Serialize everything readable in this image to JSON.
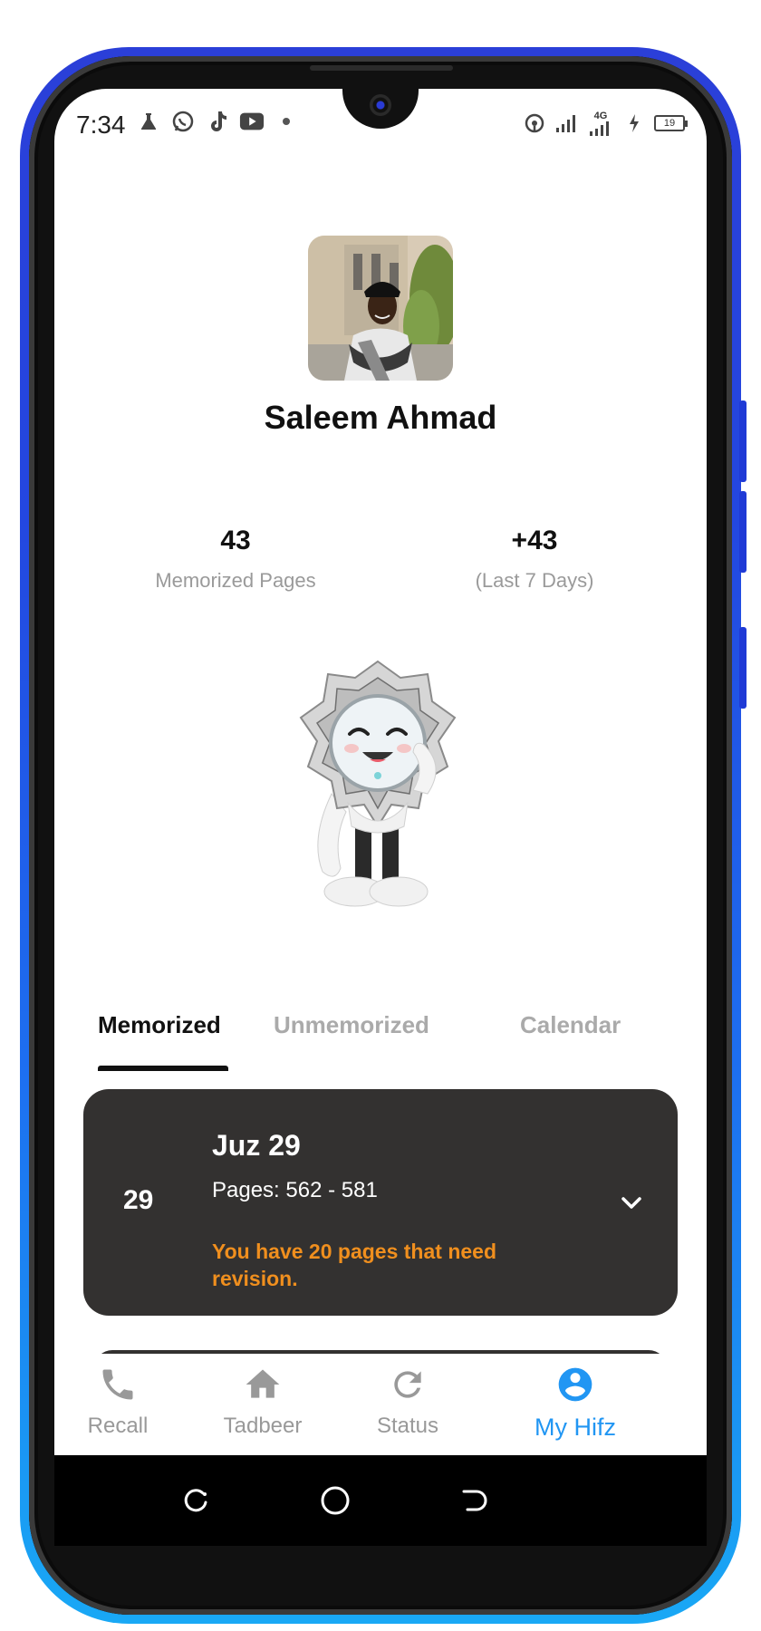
{
  "status_bar": {
    "time": "7:34",
    "left_icons": [
      "flask-icon",
      "whatsapp-icon",
      "tiktok-icon",
      "youtube-icon",
      "dot-icon"
    ],
    "right_icons": [
      "hotspot-icon",
      "signal-icon",
      "signal-4g-icon",
      "charging-icon",
      "battery-icon"
    ],
    "network": "4G",
    "battery": "19"
  },
  "profile": {
    "name": "Saleem Ahmad"
  },
  "stats": {
    "memorized_value": "43",
    "memorized_label": "Memorized Pages",
    "recent_value": "+43",
    "recent_label": "(Last 7 Days)"
  },
  "tabs": [
    {
      "label": "Memorized",
      "active": true
    },
    {
      "label": "Unmemorized",
      "active": false
    },
    {
      "label": "Calendar",
      "active": false
    }
  ],
  "juz_card": {
    "number": "29",
    "title": "Juz 29",
    "pages": "Pages: 562 - 581",
    "warning": "You have 20 pages that need revision."
  },
  "bottom_nav": [
    {
      "label": "Recall",
      "icon": "phone-icon",
      "active": false
    },
    {
      "label": "Tadbeer",
      "icon": "home-icon",
      "active": false
    },
    {
      "label": "Status",
      "icon": "refresh-icon",
      "active": false
    },
    {
      "label": "My Hifz",
      "icon": "account-circle-icon",
      "active": true
    }
  ],
  "system_nav": [
    "recents-icon",
    "home-circle-icon",
    "back-icon"
  ],
  "colors": {
    "accent": "#2196f3",
    "card_bg": "#333130",
    "warning": "#f08f1e",
    "inactive": "#999999"
  }
}
